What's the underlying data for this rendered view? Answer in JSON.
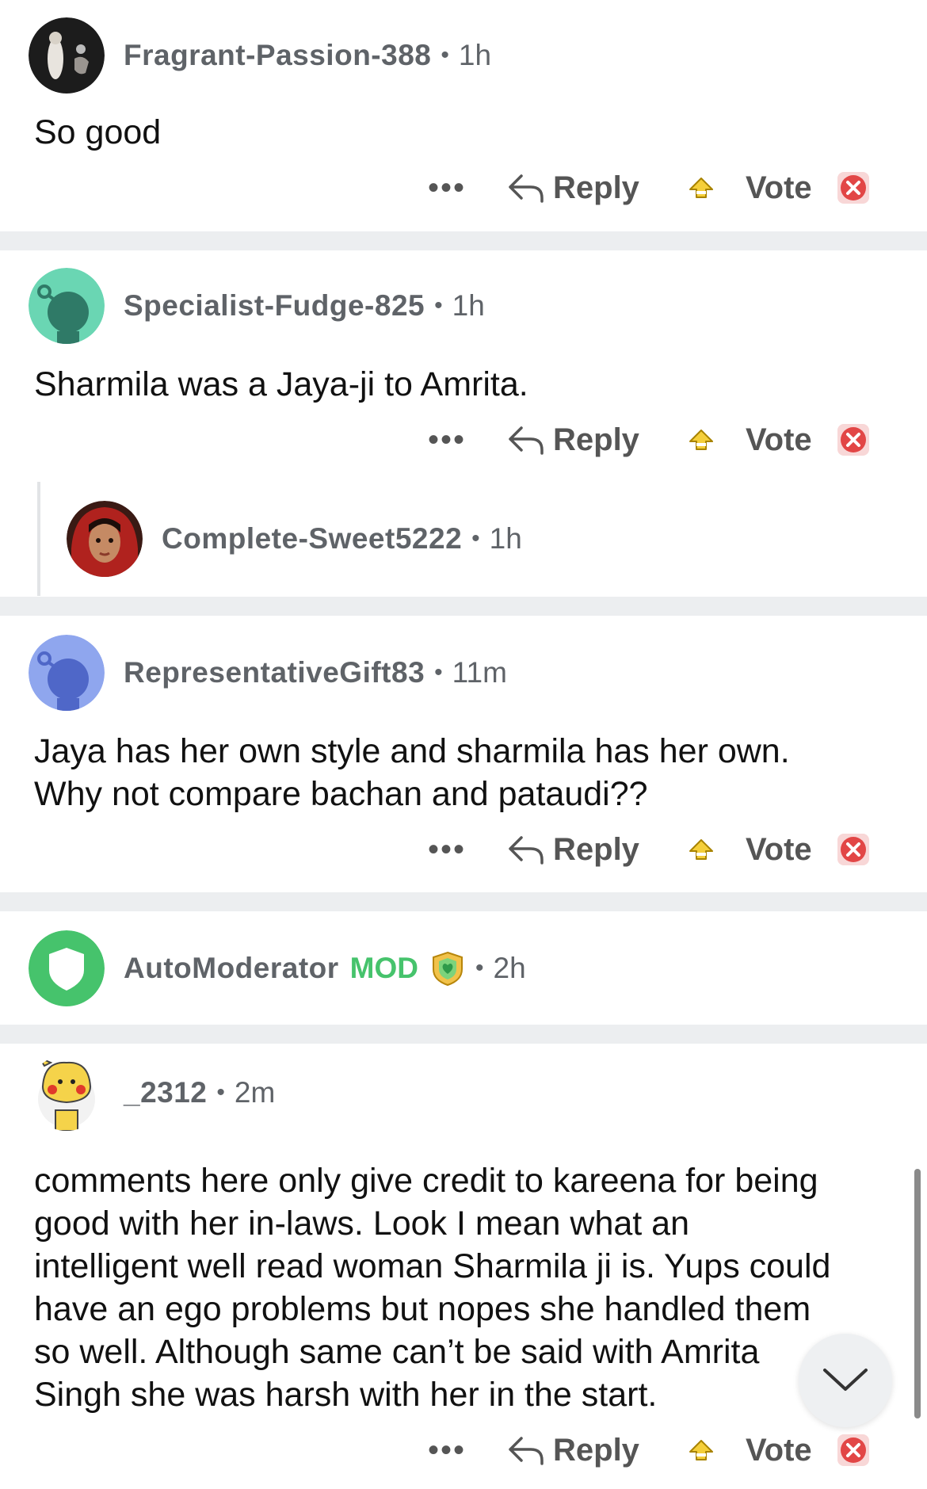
{
  "comments": [
    {
      "username": "Fragrant-Passion-388",
      "age": "1h",
      "text": "So good"
    },
    {
      "username": "Specialist-Fudge-825",
      "age": "1h",
      "text": "Sharmila was a Jaya-ji to Amrita."
    },
    {
      "username": "Complete-Sweet5222",
      "age": "1h"
    },
    {
      "username": "RepresentativeGift83",
      "age": "11m",
      "text_lines": [
        "Jaya has her own style and sharmila has her own.",
        "Why not compare bachan and pataudi??"
      ]
    },
    {
      "username": "AutoModerator",
      "mod_label": "MOD",
      "age": "2h"
    },
    {
      "username": "_2312",
      "age": "2m",
      "text_lines": [
        "comments here only give credit to kareena for being",
        "good with her in-laws. Look I mean what an",
        "intelligent well read woman Sharmila ji is. Yups could",
        "have an ego problems but nopes she handled them",
        "so well. Although same can’t be said with Amrita",
        "Singh she was harsh with her in the start."
      ]
    }
  ],
  "actions": {
    "more": "•••",
    "reply": "Reply",
    "vote": "Vote"
  },
  "separator": "•",
  "icons": {
    "more": "more-dots-icon",
    "reply": "reply-arrow-icon",
    "upvote": "upvote-icon",
    "downvote": "downvote-icon",
    "scroll": "chevron-down-icon",
    "mod": "mod-shield-icon"
  },
  "colors": {
    "mod": "#46c36c",
    "divider": "#eceef0",
    "meta": "#5f6368"
  }
}
